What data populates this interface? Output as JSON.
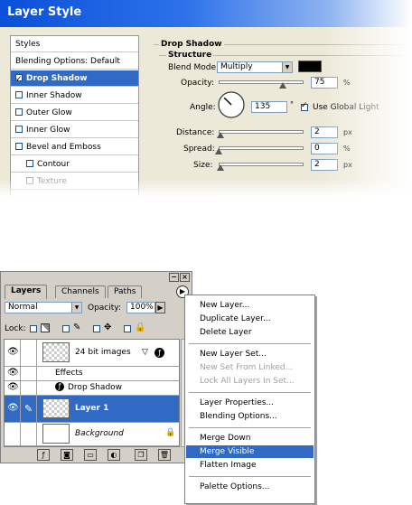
{
  "layer_style": {
    "title": "Layer Style",
    "styles_list": [
      {
        "label": "Styles",
        "checkbox": false,
        "checked": false,
        "selected": false,
        "indent": false,
        "disabled": false
      },
      {
        "label": "Blending Options: Default",
        "checkbox": false,
        "checked": false,
        "selected": false,
        "indent": false,
        "disabled": false
      },
      {
        "label": "Drop Shadow",
        "checkbox": true,
        "checked": true,
        "selected": true,
        "indent": false,
        "disabled": false
      },
      {
        "label": "Inner Shadow",
        "checkbox": true,
        "checked": false,
        "selected": false,
        "indent": false,
        "disabled": false
      },
      {
        "label": "Outer Glow",
        "checkbox": true,
        "checked": false,
        "selected": false,
        "indent": false,
        "disabled": false
      },
      {
        "label": "Inner Glow",
        "checkbox": true,
        "checked": false,
        "selected": false,
        "indent": false,
        "disabled": false
      },
      {
        "label": "Bevel and Emboss",
        "checkbox": true,
        "checked": false,
        "selected": false,
        "indent": false,
        "disabled": false
      },
      {
        "label": "Contour",
        "checkbox": true,
        "checked": false,
        "selected": false,
        "indent": true,
        "disabled": false
      },
      {
        "label": "Texture",
        "checkbox": true,
        "checked": false,
        "selected": false,
        "indent": true,
        "disabled": true
      }
    ],
    "drop_shadow": {
      "group_title": "Drop Shadow",
      "structure_title": "Structure",
      "blend_mode_label": "Blend Mode:",
      "blend_mode_value": "Multiply",
      "shadow_color": "#000000",
      "opacity_label": "Opacity:",
      "opacity_value": "75",
      "opacity_fraction": 0.75,
      "opacity_unit": "%",
      "angle_label": "Angle:",
      "angle_value": "135",
      "angle_unit": "°",
      "use_global_light_label": "Use Global Light",
      "use_global_light_checked": true,
      "distance_label": "Distance:",
      "distance_value": "2",
      "distance_unit": "px",
      "spread_label": "Spread:",
      "spread_value": "0",
      "spread_unit": "%",
      "size_label": "Size:",
      "size_value": "2",
      "size_unit": "px"
    }
  },
  "layers_palette": {
    "tabs": [
      "Layers",
      "Channels",
      "Paths"
    ],
    "active_tab": "Layers",
    "blend_mode": "Normal",
    "opacity_label": "Opacity:",
    "opacity_value": "100%",
    "lock_label": "Lock:",
    "layers": [
      {
        "name": "24 bit images",
        "type": "layer",
        "visible": true,
        "selected": false,
        "italic": false,
        "has_effects": true
      },
      {
        "name": "Effects",
        "type": "effects-header",
        "visible": true
      },
      {
        "name": "Drop Shadow",
        "type": "effect",
        "visible": true
      },
      {
        "name": "Layer 1",
        "type": "layer",
        "visible": true,
        "selected": true,
        "italic": false,
        "has_effects": false
      },
      {
        "name": "Background",
        "type": "layer",
        "visible": false,
        "selected": false,
        "italic": true,
        "locked": true
      }
    ]
  },
  "context_menu": {
    "items": [
      {
        "label": "New Layer...",
        "disabled": false,
        "highlighted": false
      },
      {
        "label": "Duplicate Layer...",
        "disabled": false,
        "highlighted": false
      },
      {
        "label": "Delete Layer",
        "disabled": false,
        "highlighted": false
      },
      {
        "separator": true
      },
      {
        "label": "New Layer Set...",
        "disabled": false,
        "highlighted": false
      },
      {
        "label": "New Set From Linked...",
        "disabled": true,
        "highlighted": false
      },
      {
        "label": "Lock All Layers In Set...",
        "disabled": true,
        "highlighted": false
      },
      {
        "separator": true
      },
      {
        "label": "Layer Properties...",
        "disabled": false,
        "highlighted": false
      },
      {
        "label": "Blending Options...",
        "disabled": false,
        "highlighted": false
      },
      {
        "separator": true
      },
      {
        "label": "Merge Down",
        "disabled": false,
        "highlighted": false
      },
      {
        "label": "Merge Visible",
        "disabled": false,
        "highlighted": true
      },
      {
        "label": "Flatten Image",
        "disabled": false,
        "highlighted": false
      },
      {
        "separator": true
      },
      {
        "label": "Palette Options...",
        "disabled": false,
        "highlighted": false
      }
    ]
  },
  "colors": {
    "selection": "#316ac5",
    "dialog_bg": "#ece9d8",
    "palette_bg": "#d4d0c8"
  }
}
